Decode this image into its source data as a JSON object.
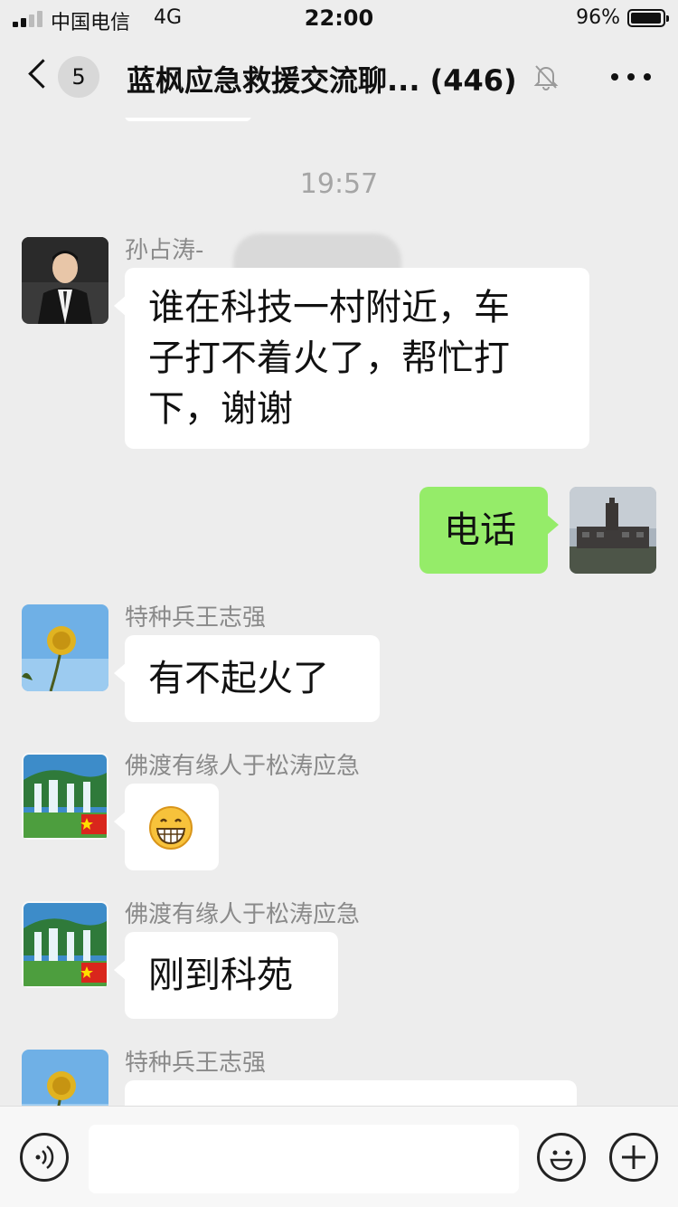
{
  "status_bar": {
    "carrier": "中国电信",
    "network": "4G",
    "time": "22:00",
    "battery_percent": "96%",
    "battery_level": 0.96
  },
  "nav": {
    "back_icon": "chevron-left-icon",
    "unread_count": "5",
    "title": "蓝枫应急救援交流聊... (446)",
    "mute_icon": "bell-off-icon",
    "more_icon": "more-dots-icon"
  },
  "chat": {
    "timestamp": "19:57",
    "messages": [
      {
        "sender": "孙占涛-",
        "text_lines": [
          "谁在科技一村附近，车",
          "子打不着火了，帮忙打",
          "下，谢谢"
        ],
        "avatar": "man-in-suit-avatar"
      },
      {
        "mine": true,
        "text": "电话",
        "avatar": "building-photo-avatar"
      },
      {
        "sender": "特种兵王志强",
        "text": "有不起火了",
        "avatar": "dandelion-avatar"
      },
      {
        "sender": "佛渡有缘人于松涛应急",
        "emoji": "😁",
        "avatar": "waterfall-flag-avatar"
      },
      {
        "sender": "佛渡有缘人于松涛应急",
        "text": "刚到科苑",
        "avatar": "waterfall-flag-avatar"
      },
      {
        "sender": "特种兵王志强",
        "avatar": "dandelion-avatar"
      }
    ]
  },
  "input_bar": {
    "voice_icon": "voice-icon",
    "emoji_icon": "emoji-icon",
    "plus_icon": "plus-icon",
    "value": ""
  },
  "colors": {
    "background": "#ededed",
    "bubble_other": "#ffffff",
    "bubble_mine": "#95ec69",
    "timestamp": "#a5a5a5",
    "sender_name": "#8a8a8a"
  }
}
